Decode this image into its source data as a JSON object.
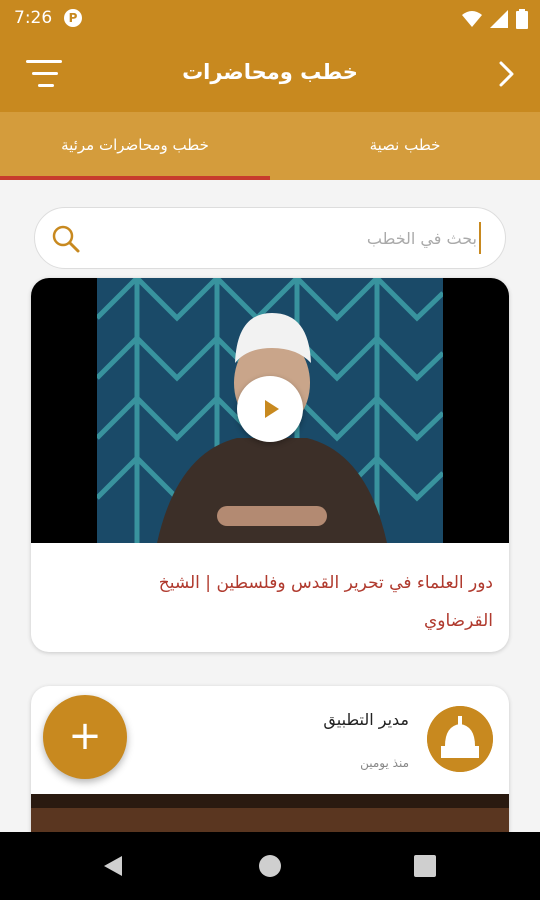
{
  "status_bar": {
    "time": "7:26",
    "notification": "P"
  },
  "app_bar": {
    "title": "خطب ومحاضرات"
  },
  "tabs": [
    {
      "label": "خطب ومحاضرات مرئية",
      "selected": true
    },
    {
      "label": "خطب نصية",
      "selected": false
    }
  ],
  "search": {
    "placeholder": "بحث في الخطب",
    "value": ""
  },
  "posts": [
    {
      "title": "دور العلماء في تحرير القدس وفلسطين | الشيخ القرضاوي"
    },
    {
      "author": "مدير التطبيق",
      "time": "منذ يومين"
    }
  ],
  "colors": {
    "primary": "#c8891f",
    "tab_bg": "#d49c3c",
    "indicator": "#c73b2d",
    "title_red": "#b03a2e"
  },
  "icons": [
    "menu-icon",
    "back-chevron-icon",
    "search-icon",
    "play-icon",
    "add-icon",
    "nav-back-icon",
    "nav-home-icon",
    "nav-recents-icon"
  ]
}
